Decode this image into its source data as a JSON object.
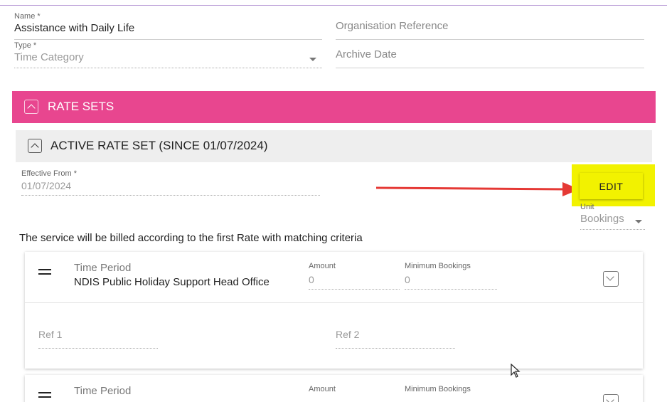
{
  "form": {
    "name_label": "Name *",
    "name_value": "Assistance with Daily Life",
    "org_ref_placeholder": "Organisation Reference",
    "type_label": "Type *",
    "type_value": "Time Category",
    "archive_placeholder": "Archive Date"
  },
  "rate_sets": {
    "title": "RATE SETS",
    "active_title": "ACTIVE RATE SET (SINCE 01/07/2024)",
    "effective_label": "Effective From *",
    "effective_value": "01/07/2024",
    "edit_label": "EDIT",
    "unit_label": "Unit",
    "unit_value": "Bookings",
    "billing_text": "The service will be billed according to the first Rate with matching criteria"
  },
  "rates": [
    {
      "time_period_label": "Time Period",
      "time_period_value": "NDIS Public Holiday Support Head Office",
      "amount_label": "Amount",
      "amount_value": "0",
      "min_label": "Minimum Bookings",
      "min_value": "0",
      "ref1_placeholder": "Ref 1",
      "ref2_placeholder": "Ref 2"
    },
    {
      "time_period_label": "Time Period",
      "amount_label": "Amount",
      "min_label": "Minimum Bookings"
    }
  ],
  "colors": {
    "rate_sets_band": "#e8468f",
    "highlight": "#f2f200",
    "arrow": "#e53935"
  },
  "icons": {
    "collapse": "chevron-up-icon",
    "expand": "chevron-down-icon",
    "drag": "drag-handle-icon",
    "dropdown": "caret-down-icon",
    "cursor": "mouse-pointer-icon"
  }
}
